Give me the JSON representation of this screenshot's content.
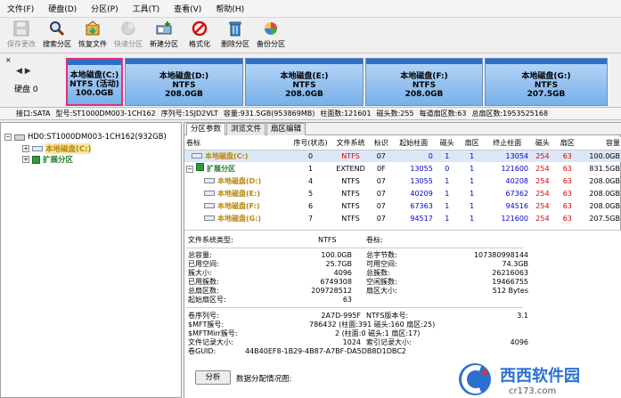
{
  "menu": [
    "文件(F)",
    "硬盘(D)",
    "分区(P)",
    "工具(T)",
    "查看(V)",
    "帮助(H)"
  ],
  "toolbar": [
    {
      "label": "保存更改",
      "icon": "save-icon",
      "disabled": true
    },
    {
      "label": "搜索分区",
      "icon": "search-icon",
      "disabled": false
    },
    {
      "label": "恢复文件",
      "icon": "recover-icon",
      "disabled": false
    },
    {
      "label": "快速分区",
      "icon": "quick-partition-icon",
      "disabled": true
    },
    {
      "label": "新建分区",
      "icon": "new-partition-icon",
      "disabled": false
    },
    {
      "label": "格式化",
      "icon": "format-icon",
      "disabled": false
    },
    {
      "label": "删除分区",
      "icon": "delete-icon",
      "disabled": false
    },
    {
      "label": "备份分区",
      "icon": "backup-icon",
      "disabled": false
    }
  ],
  "disk_bar": {
    "close": "×",
    "arrows": "◀ ▶",
    "disk_label": "硬盘 0",
    "partitions": [
      {
        "line1": "本地磁盘(C:)",
        "line2": "NTFS (活动)",
        "line3": "100.0GB",
        "active": true
      },
      {
        "line1": "本地磁盘(D:)",
        "line2": "NTFS",
        "line3": "208.0GB",
        "active": false
      },
      {
        "line1": "本地磁盘(E:)",
        "line2": "NTFS",
        "line3": "208.0GB",
        "active": false
      },
      {
        "line1": "本地磁盘(F:)",
        "line2": "NTFS",
        "line3": "208.0GB",
        "active": false
      },
      {
        "line1": "本地磁盘(G:)",
        "line2": "NTFS",
        "line3": "207.5GB",
        "active": false
      }
    ]
  },
  "info_line": [
    "接口:SATA",
    "型号:ST1000DM003-1CH162",
    "序列号:1SJD2VLT",
    "容量:931.5GB(953869MB)",
    "柱面数:121601",
    "磁头数:255",
    "每道扇区数:63",
    "总扇区数:1953525168"
  ],
  "tree": {
    "disk": "HD0:ST1000DM003-1CH162(932GB)",
    "c": "本地磁盘(C:)",
    "ext": "扩展分区"
  },
  "tabs": [
    "分区参数",
    "浏览文件",
    "扇区编辑"
  ],
  "table": {
    "headers": [
      "卷标",
      "序号(状态)",
      "文件系统",
      "标识",
      "起始柱面",
      "磁头",
      "扇区",
      "终止柱面",
      "磁头",
      "扇区",
      "容量"
    ],
    "rows": [
      {
        "name": "本地磁盘(C:)",
        "seq": "0",
        "fs": "NTFS",
        "id": "07",
        "sc": "0",
        "sh": "1",
        "ss": "1",
        "ec": "13054",
        "eh": "254",
        "es": "63",
        "cap": "100.0GB"
      },
      {
        "name": "扩展分区",
        "seq": "1",
        "fs": "EXTEND",
        "id": "0F",
        "sc": "13055",
        "sh": "0",
        "ss": "1",
        "ec": "121600",
        "eh": "254",
        "es": "63",
        "cap": "831.5GB"
      },
      {
        "name": "本地磁盘(D:)",
        "seq": "4",
        "fs": "NTFS",
        "id": "07",
        "sc": "13055",
        "sh": "1",
        "ss": "1",
        "ec": "40208",
        "eh": "254",
        "es": "63",
        "cap": "208.0GB"
      },
      {
        "name": "本地磁盘(E:)",
        "seq": "5",
        "fs": "NTFS",
        "id": "07",
        "sc": "40209",
        "sh": "1",
        "ss": "1",
        "ec": "67362",
        "eh": "254",
        "es": "63",
        "cap": "208.0GB"
      },
      {
        "name": "本地磁盘(F:)",
        "seq": "6",
        "fs": "NTFS",
        "id": "07",
        "sc": "67363",
        "sh": "1",
        "ss": "1",
        "ec": "94516",
        "eh": "254",
        "es": "63",
        "cap": "208.0GB"
      },
      {
        "name": "本地磁盘(G:)",
        "seq": "7",
        "fs": "NTFS",
        "id": "07",
        "sc": "94517",
        "sh": "1",
        "ss": "1",
        "ec": "121600",
        "eh": "254",
        "es": "63",
        "cap": "207.5GB"
      }
    ]
  },
  "details": {
    "fs_type_label": "文件系统类型:",
    "fs_type": "NTFS",
    "vol_label": "卷标:",
    "total_cap_label": "总容量:",
    "total_cap": "100.0GB",
    "total_bytes_label": "总字节数:",
    "total_bytes": "107380998144",
    "used_label": "已用空间:",
    "used": "25.7GB",
    "free_label": "可用空间:",
    "free": "74.3GB",
    "cluster_label": "簇大小:",
    "cluster": "4096",
    "total_clusters_label": "总簇数:",
    "total_clusters": "26216063",
    "used_clusters_label": "已用簇数:",
    "used_clusters": "6749308",
    "free_clusters_label": "空闲簇数:",
    "free_clusters": "19466755",
    "total_sectors_label": "总扇区数:",
    "total_sectors": "209728512",
    "sector_size_label": "扇区大小:",
    "sector_size": "512 Bytes",
    "start_sector_label": "起始扇区号:",
    "start_sector": "63",
    "serial_label": "卷序列号:",
    "serial": "2A7D-995F",
    "ntfs_ver_label": "NTFS版本号:",
    "ntfs_ver": "3.1",
    "mft_label": "$MFT簇号:",
    "mft": "786432 (柱面:391 磁头:160 扇区:25)",
    "mftmirr_label": "$MFTMirr簇号:",
    "mftmirr": "2 (柱面:0 磁头:1 扇区:17)",
    "record_label": "文件记录大小:",
    "record": "1024",
    "index_label": "索引记录大小:",
    "index": "4096",
    "guid_label": "卷GUID:",
    "guid": "44B40EF8-1B29-4B87-A7BF-DA5DB8D1DBC2",
    "analyze": "分析",
    "dist_label": "数据分配情况图:"
  },
  "watermark": {
    "text": "西西软件园",
    "sub": "cr173.com"
  }
}
